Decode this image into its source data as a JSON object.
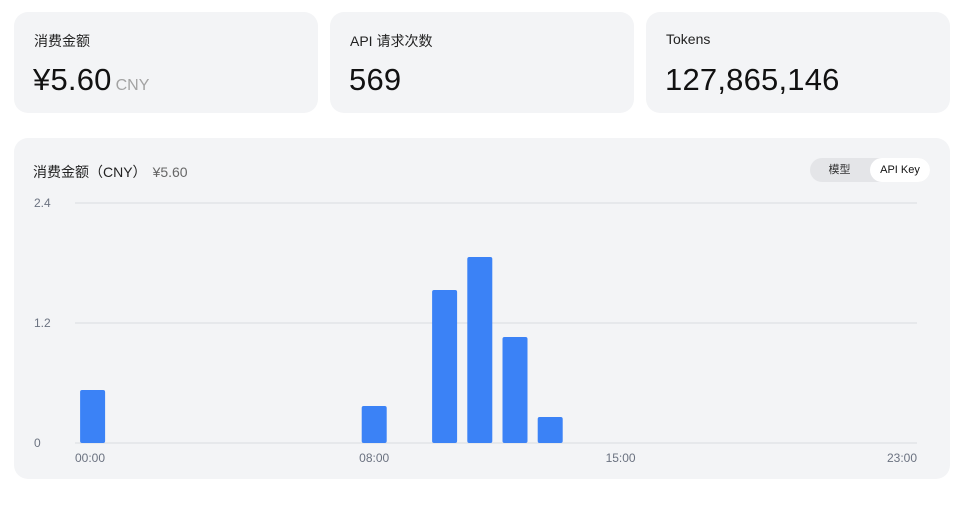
{
  "stats": [
    {
      "label": "消费金额",
      "value": "¥5.60",
      "unit": "CNY"
    },
    {
      "label": "API 请求次数",
      "value": "569",
      "unit": ""
    },
    {
      "label": "Tokens",
      "value": "127,865,146",
      "unit": ""
    }
  ],
  "chart_panel": {
    "title": "消费金额（CNY）",
    "total": "¥5.60",
    "toggle": {
      "options": [
        "模型",
        "API Key"
      ],
      "selected": "API Key"
    }
  },
  "colors": {
    "bar": "#3b82f6",
    "card_bg": "#f3f4f6",
    "grid": "#d9dbe0"
  },
  "chart_data": {
    "type": "bar",
    "title": "消费金额（CNY）",
    "xlabel": "",
    "ylabel": "",
    "ylim": [
      0,
      2.4
    ],
    "yticks": [
      "0",
      "1.2",
      "2.4"
    ],
    "xticks": [
      "00:00",
      "08:00",
      "15:00",
      "23:00"
    ],
    "categories": [
      "00:00",
      "01:00",
      "02:00",
      "03:00",
      "04:00",
      "05:00",
      "06:00",
      "07:00",
      "08:00",
      "09:00",
      "10:00",
      "11:00",
      "12:00",
      "13:00",
      "14:00",
      "15:00",
      "16:00",
      "17:00",
      "18:00",
      "19:00",
      "20:00",
      "21:00",
      "22:00",
      "23:00"
    ],
    "values": [
      0.53,
      0,
      0,
      0,
      0,
      0,
      0,
      0,
      0.37,
      0,
      1.53,
      1.86,
      1.06,
      0.26,
      0,
      0,
      0,
      0,
      0,
      0,
      0,
      0,
      0,
      0
    ],
    "grid": true,
    "legend": "none"
  }
}
